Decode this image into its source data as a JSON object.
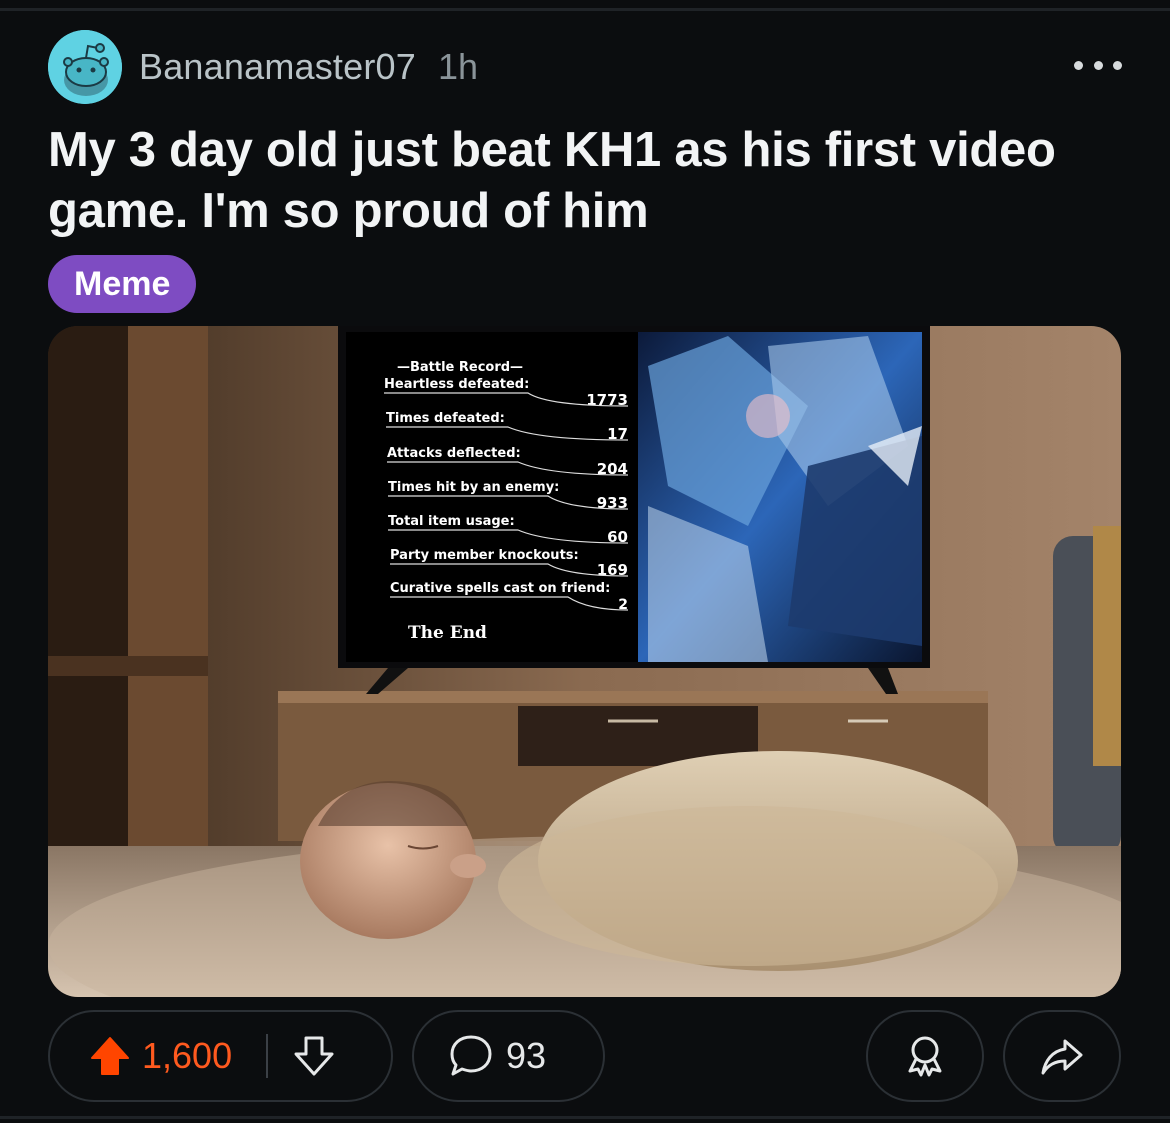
{
  "post": {
    "username": "Bananamaster07",
    "time": "1h",
    "title": "My 3 day old just beat KH1 as his first video game. I'm so proud of him",
    "flair": "Meme",
    "flair_color": "#7e4cc2"
  },
  "image": {
    "battle_record": {
      "heading": "—Battle Record—",
      "rows": [
        {
          "label": "Heartless defeated:",
          "value": "1773"
        },
        {
          "label": "Times defeated:",
          "value": "17"
        },
        {
          "label": "Attacks deflected:",
          "value": "204"
        },
        {
          "label": "Times hit by an enemy:",
          "value": "933"
        },
        {
          "label": "Total item usage:",
          "value": "60"
        },
        {
          "label": "Party member knockouts:",
          "value": "169"
        },
        {
          "label": "Curative spells cast on friend:",
          "value": "2"
        }
      ],
      "footer": "The End"
    }
  },
  "actions": {
    "upvotes": "1,600",
    "comments": "93",
    "upvote_color": "#ff4500"
  },
  "icons": {
    "more": "more-icon",
    "upvote": "upvote-icon",
    "downvote": "downvote-icon",
    "comment": "comment-icon",
    "award": "award-icon",
    "share": "share-icon"
  }
}
